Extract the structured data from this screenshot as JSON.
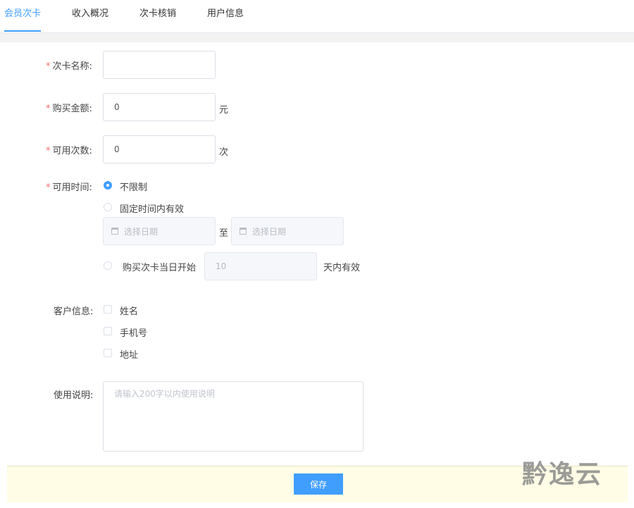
{
  "tabs": [
    {
      "label": "会员次卡",
      "active": true
    },
    {
      "label": "收入概况",
      "active": false
    },
    {
      "label": "次卡核销",
      "active": false
    },
    {
      "label": "用户信息",
      "active": false
    }
  ],
  "form": {
    "card_name": {
      "required_mark": "*",
      "label": "次卡名称:",
      "value": ""
    },
    "price": {
      "required_mark": "*",
      "label": "购买金额:",
      "value": "0",
      "unit": "元"
    },
    "times": {
      "required_mark": "*",
      "label": "可用次数:",
      "value": "0",
      "unit": "次"
    },
    "validity": {
      "required_mark": "*",
      "label": "可用时间:",
      "options": [
        {
          "label": "不限制",
          "selected": true
        },
        {
          "label": "固定时间内有效",
          "selected": false
        },
        {
          "label": "购买次卡当日开始",
          "selected": false
        }
      ],
      "start_date_placeholder": "选择日期",
      "range_separator": "至",
      "end_date_placeholder": "选择日期",
      "days_value": "10",
      "days_suffix": "天内有效"
    },
    "customer_info": {
      "label": "客户信息:",
      "options": [
        {
          "label": "姓名",
          "checked": false
        },
        {
          "label": "手机号",
          "checked": false
        },
        {
          "label": "地址",
          "checked": false
        }
      ]
    },
    "usage": {
      "label": "使用说明:",
      "placeholder": "请输入200字以内使用说明",
      "value": ""
    }
  },
  "footer": {
    "save_label": "保存"
  },
  "watermark": {
    "text": "黔逸云"
  },
  "colors": {
    "accent": "#409eff",
    "required": "#f56c6c",
    "footer_bg": "#fffde6"
  }
}
